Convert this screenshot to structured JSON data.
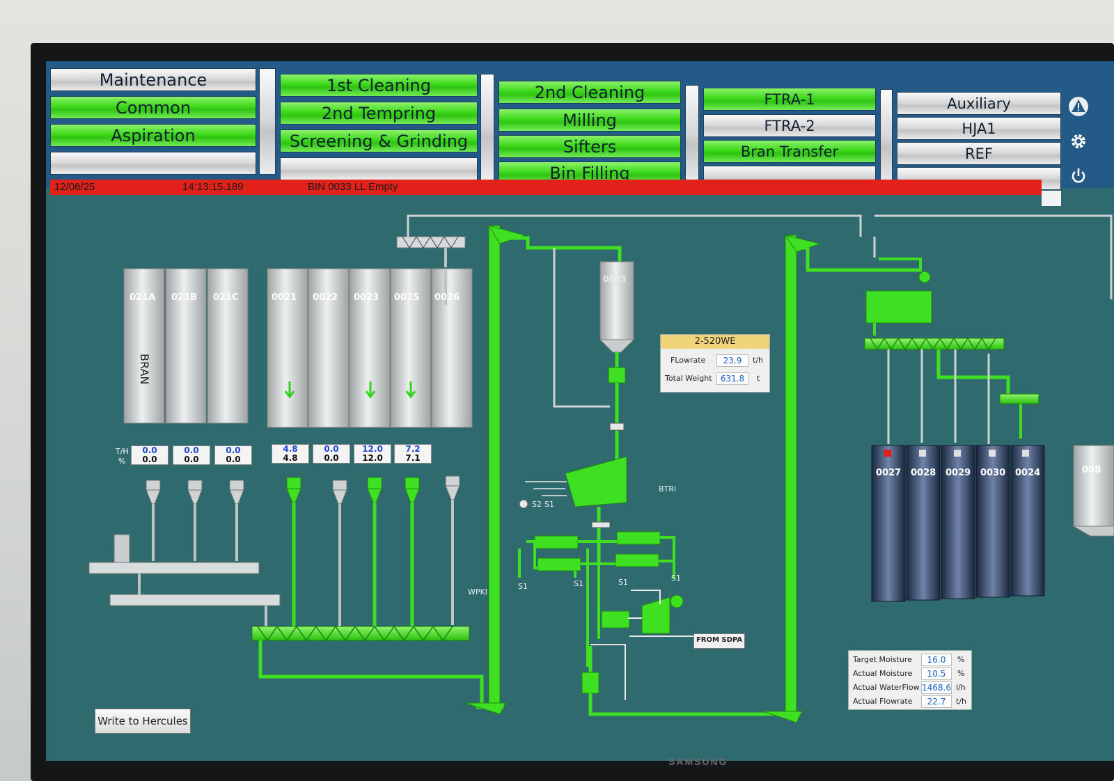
{
  "nav": {
    "col1": [
      "Maintenance",
      "Common",
      "Aspiration",
      ""
    ],
    "col2": [
      "1st Cleaning",
      "2nd Tempring",
      "Screening & Grinding",
      ""
    ],
    "col3": [
      "2nd Cleaning",
      "Milling",
      "Sifters",
      "Bin Filling"
    ],
    "col4": [
      "FTRA-1",
      "FTRA-2",
      "Bran Transfer",
      ""
    ],
    "col5": [
      "Auxiliary",
      "HJA1",
      "REF",
      ""
    ],
    "icons": [
      "warning-icon",
      "gear-icon",
      "power-icon"
    ]
  },
  "alarm": {
    "date": "12/06/25",
    "time": "14:13:15.189",
    "message": "BIN 0033 LL Empty",
    "color": "#e2221a"
  },
  "bins_left": {
    "bran_group": [
      "021A",
      "021B",
      "021C"
    ],
    "bran_label": "BRAN",
    "bin_group": [
      "0021",
      "0022",
      "0023",
      "0025",
      "0026"
    ]
  },
  "readings": {
    "row_label_top": "T/H",
    "row_label_bottom": "%",
    "values": [
      {
        "sp": "0.0",
        "pv": "0.0"
      },
      {
        "sp": "0.0",
        "pv": "0.0"
      },
      {
        "sp": "0.0",
        "pv": "0.0"
      },
      {
        "sp": "4.8",
        "pv": "4.8"
      },
      {
        "sp": "0.0",
        "pv": "0.0"
      },
      {
        "sp": "12.0",
        "pv": "12.0"
      },
      {
        "sp": "7.2",
        "pv": "7.1"
      }
    ]
  },
  "center": {
    "silo": "0033",
    "scale": {
      "title": "2-520WE",
      "flow_label": "FLowrate",
      "flow": "23.9",
      "flow_unit": "t/h",
      "weight_label": "Total Weight",
      "weight": "631.8",
      "weight_unit": "t"
    },
    "tags": [
      "S2",
      "S1",
      "S1",
      "S1",
      "S1",
      "S1",
      "BTRI",
      "WPKI"
    ],
    "from_label": "FROM SDPA"
  },
  "bins_right": {
    "bins": [
      "0027",
      "0028",
      "0029",
      "0030",
      "0024"
    ],
    "partial": "008"
  },
  "moisture": {
    "rows": [
      {
        "label": "Target Moisture",
        "value": "16.0",
        "unit": "%"
      },
      {
        "label": "Actual Moisture",
        "value": "10.5",
        "unit": "%"
      },
      {
        "label": "Actual WaterFlow",
        "value": "1468.6",
        "unit": "l/h"
      },
      {
        "label": "Actual Flowrate",
        "value": "22.7",
        "unit": "t/h"
      }
    ]
  },
  "write_button": "Write to Hercules",
  "monitor_brand": "SAMSUNG",
  "colors": {
    "process_green": "#3ee021",
    "screen_bg": "#2f6a6e",
    "nav_blue": "#235a88"
  }
}
